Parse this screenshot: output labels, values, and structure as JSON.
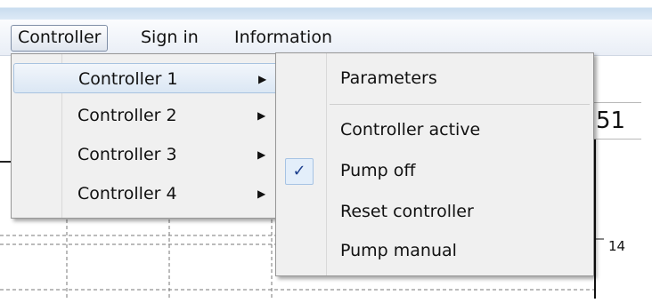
{
  "menubar": {
    "items": [
      {
        "label": "Controller"
      },
      {
        "label": "Sign in"
      },
      {
        "label": "Information"
      }
    ]
  },
  "controller_menu": {
    "items": [
      {
        "label": "Controller 1",
        "highlighted": true
      },
      {
        "label": "Controller 2"
      },
      {
        "label": "Controller 3"
      },
      {
        "label": "Controller 4"
      }
    ]
  },
  "submenu": {
    "items": [
      {
        "label": "Parameters"
      },
      {
        "label": "Controller active"
      },
      {
        "label": "Pump off",
        "checked": true
      },
      {
        "label": "Reset controller"
      },
      {
        "label": "Pump manual"
      }
    ]
  },
  "background": {
    "value_display": "51",
    "axis_tick": "14"
  },
  "colors": {
    "highlight": "#dbe7f4",
    "check": "#1c3f8e",
    "menu_bg": "#f0f0f0"
  }
}
